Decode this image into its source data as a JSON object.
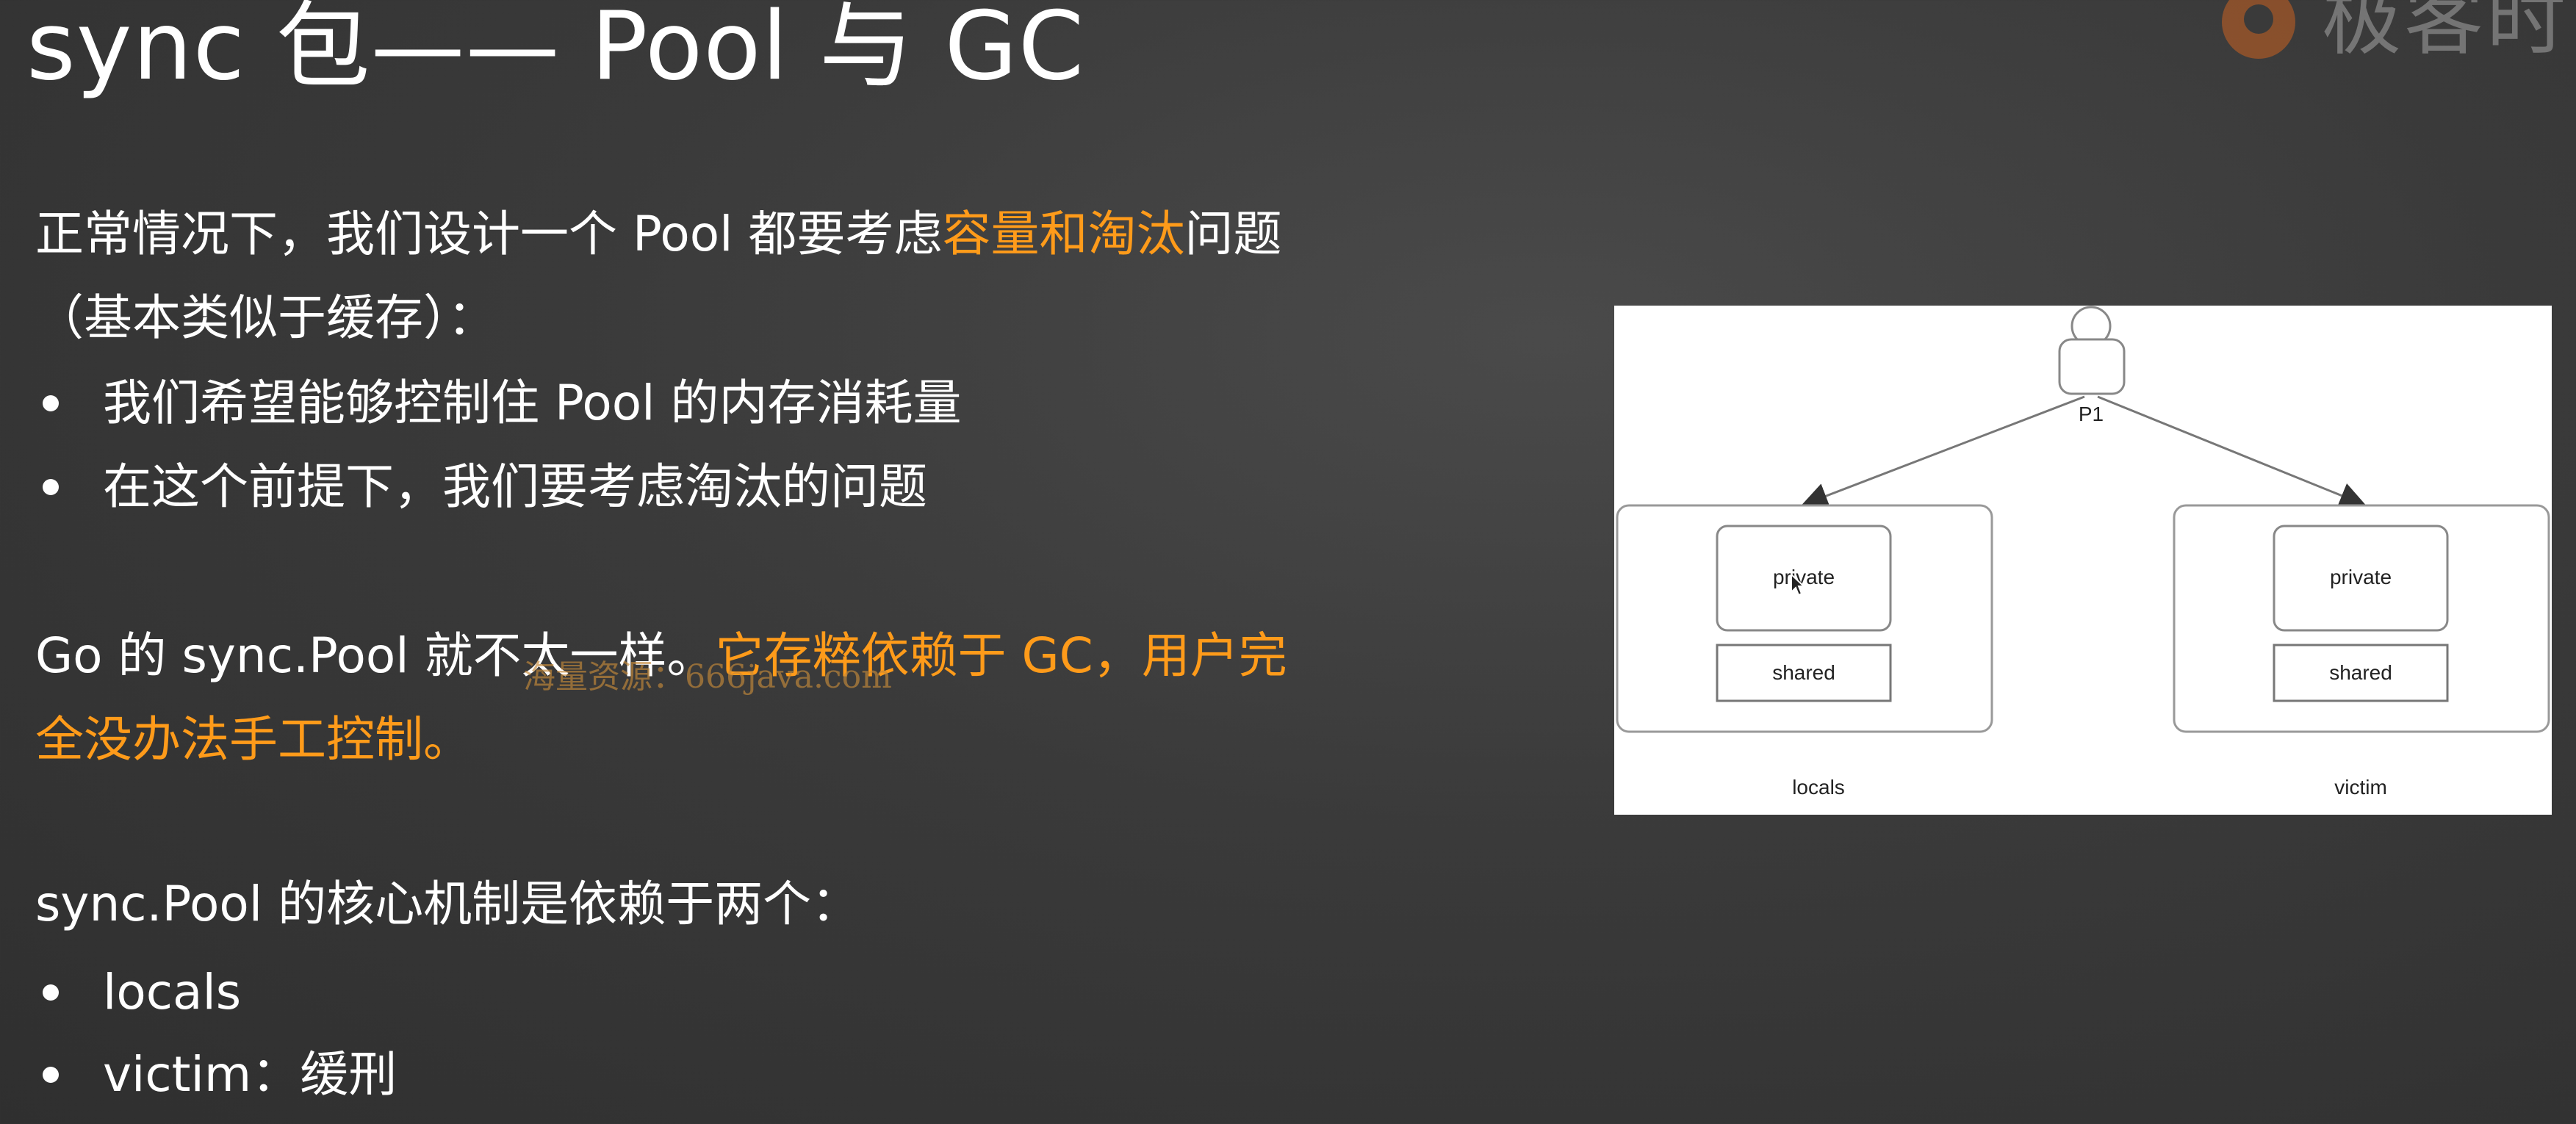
{
  "title": "sync 包—— Pool 与 GC",
  "logo_text": "极客时",
  "intro": {
    "line1_before": "正常情况下，我们设计一个 Pool 都要考虑",
    "line1_highlight": "容量和淘汰",
    "line1_after": "问题",
    "line2": "（基本类似于缓存）：",
    "bullets": [
      "我们希望能够控制住 Pool 的内存消耗量",
      "在这个前提下，我们要考虑淘汰的问题"
    ]
  },
  "gc_note": {
    "line1_before": "Go 的 sync.Pool 就不太一样。",
    "line1_highlight": "它存粹依赖于 GC，用户完",
    "line2_highlight": "全没办法手工控制。"
  },
  "mechanism": {
    "heading": "sync.Pool 的核心机制是依赖于两个：",
    "bullets": [
      "locals",
      "victim：缓刑"
    ]
  },
  "watermark": "海量资源：666java.com",
  "diagram": {
    "actor_label": "P1",
    "left": {
      "private": "private",
      "shared": "shared",
      "caption": "locals"
    },
    "right": {
      "private": "private",
      "shared": "shared",
      "caption": "victim"
    }
  },
  "colors": {
    "highlight": "#ff9b1a",
    "background": "#3a3a3a",
    "logo": "#e86a1c"
  }
}
